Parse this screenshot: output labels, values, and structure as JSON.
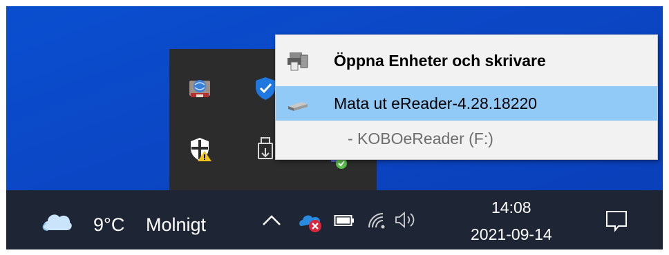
{
  "context_menu": {
    "items": [
      {
        "label": "Öppna Enheter och skrivare",
        "icon": "devices-printers-icon",
        "bold": true,
        "highlighted": false
      },
      {
        "label": "Mata ut eReader-4.28.18220",
        "icon": "usb-drive-icon",
        "bold": false,
        "highlighted": true
      },
      {
        "label": "-   KOBOeReader (F:)",
        "icon": "",
        "bold": false,
        "highlighted": false
      }
    ],
    "highlight_color": "#91c9f7"
  },
  "tray_overflow": {
    "icons": [
      "network-globe-icon",
      "windows-defender-icon",
      "security-warning-shield-icon",
      "usb-eject-icon",
      "sync-check-icon"
    ]
  },
  "taskbar": {
    "weather": {
      "temperature": "9°C",
      "condition": "Molnigt",
      "icon": "cloud-icon"
    },
    "system_icons": [
      "chevron-up-icon",
      "onedrive-error-icon",
      "battery-icon",
      "wifi-icon",
      "speaker-icon"
    ],
    "clock": {
      "time": "14:08",
      "date": "2021-09-14"
    },
    "notification_icon": "notification-center-icon"
  },
  "colors": {
    "desktop": "#0b46c4",
    "taskbar": "#1e2535",
    "flyout": "#2c2c2c",
    "menu": "#f2f2f2"
  }
}
